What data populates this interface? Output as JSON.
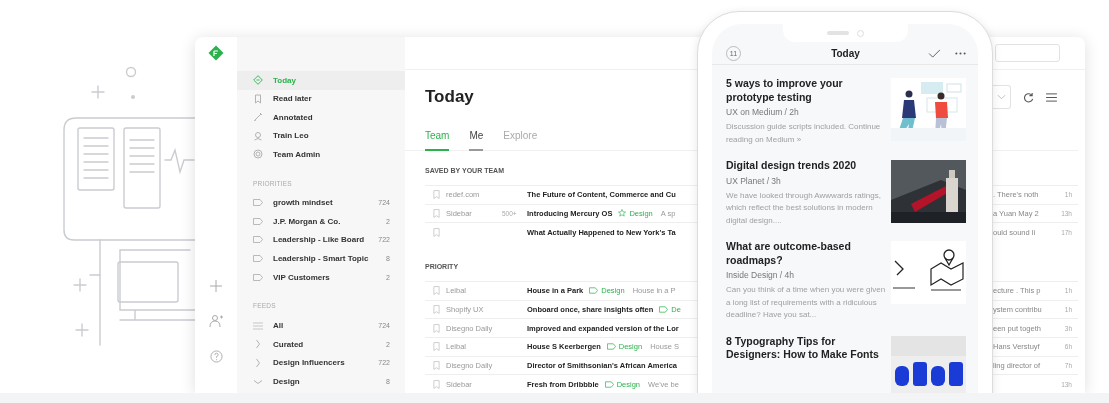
{
  "sidebar": {
    "nav": [
      {
        "kind": "today",
        "label": "Today",
        "selected": true
      },
      {
        "kind": "bookmark",
        "label": "Read later",
        "selected": false
      },
      {
        "kind": "pen",
        "label": "Annotated",
        "selected": false
      },
      {
        "kind": "bot",
        "label": "Train Leo",
        "selected": false
      },
      {
        "kind": "admin",
        "label": "Team Admin",
        "selected": false
      }
    ],
    "priorities": {
      "heading": "PRIORITIES",
      "items": [
        {
          "label": "growth mindset",
          "count": "724"
        },
        {
          "label": "J.P. Morgan & Co.",
          "count": "2"
        },
        {
          "label": "Leadership - Like Board",
          "count": "722"
        },
        {
          "label": "Leadership - Smart Topic",
          "count": "8"
        },
        {
          "label": "VIP Customers",
          "count": "2"
        }
      ]
    },
    "feeds": {
      "heading": "FEEDS",
      "items": [
        {
          "kind": "all",
          "label": "All",
          "count": "724"
        },
        {
          "kind": "folder",
          "label": "Curated",
          "count": "2",
          "expanded": false
        },
        {
          "kind": "folder",
          "label": "Design Influencers",
          "count": "722",
          "expanded": false
        },
        {
          "kind": "folder",
          "label": "Design",
          "count": "8",
          "expanded": true
        }
      ]
    }
  },
  "main": {
    "title": "Today",
    "tabs": [
      {
        "label": "Team",
        "selected": true,
        "underlined": true
      },
      {
        "label": "Me",
        "selected": false,
        "underlined": true
      },
      {
        "label": "Explore",
        "selected": false,
        "underlined": false
      }
    ],
    "sections": [
      {
        "heading": "SAVED BY YOUR TEAM",
        "rows": [
          {
            "source": "redef.com",
            "title": "The Future of Content, Commerce and Cu",
            "tail": ". There's noth",
            "time": "1h"
          },
          {
            "source": "Sidebar",
            "count": "500+",
            "title": "Introducing Mercury OS",
            "tag": {
              "kind": "star",
              "label": "Design"
            },
            "snippet": "A sp",
            "tail": "a Yuan May 2",
            "time": "13h"
          },
          {
            "title": "What Actually Happened to New York's Ta",
            "tail": "ould sound li",
            "time": "17h"
          }
        ]
      },
      {
        "heading": "PRIORITY",
        "rows": [
          {
            "source": "Leibal",
            "title": "House in a Park",
            "tag": {
              "kind": "tag",
              "label": "Design"
            },
            "snippet": "House in a P",
            "tail": "ecture . This p",
            "time": "1h"
          },
          {
            "source": "Shopify UX",
            "title": "Onboard once, share insights often",
            "tag": {
              "kind": "tag",
              "label": "De"
            },
            "tail": "ystem contribu",
            "time": "1h"
          },
          {
            "source": "Disegno Daily",
            "title": "Improved and expanded version of the Lor",
            "tail": "een put togeth",
            "time": "3h"
          },
          {
            "source": "Leibal",
            "title": "House S Keerbergen",
            "tag": {
              "kind": "tag",
              "label": "Design"
            },
            "snippet": "House S",
            "tail": "Hans Verstuyf",
            "time": "6h"
          },
          {
            "source": "Disegno Daily",
            "title": "Director of Smithsonian's African America",
            "tail": "ling director of",
            "time": "7h"
          },
          {
            "source": "Sidebar",
            "title": "Fresh from Dribbble",
            "tag": {
              "kind": "tag",
              "label": "Design"
            },
            "snippet": "We've be",
            "time": "13h"
          }
        ]
      }
    ]
  },
  "phone": {
    "badge": "11",
    "title": "Today",
    "articles": [
      {
        "title": "5 ways to improve your prototype testing",
        "meta": "UX on Medium / 2h",
        "summary": "Discussion guide scripts included. Continue reading on Medium »"
      },
      {
        "title": "Digital design trends 2020",
        "meta": "UX Planet / 3h",
        "summary": "We have looked through Awwwards ratings, which reflect the best solutions in modern digital design...."
      },
      {
        "title": "What are outcome-based roadmaps?",
        "meta": "Inside Design / 4h",
        "summary": "Can you think of a time when you were given a long list of requirements with a ridiculous deadline? Have you sat..."
      },
      {
        "title": "8 Typography Tips for Designers: How to Make Fonts"
      }
    ]
  }
}
